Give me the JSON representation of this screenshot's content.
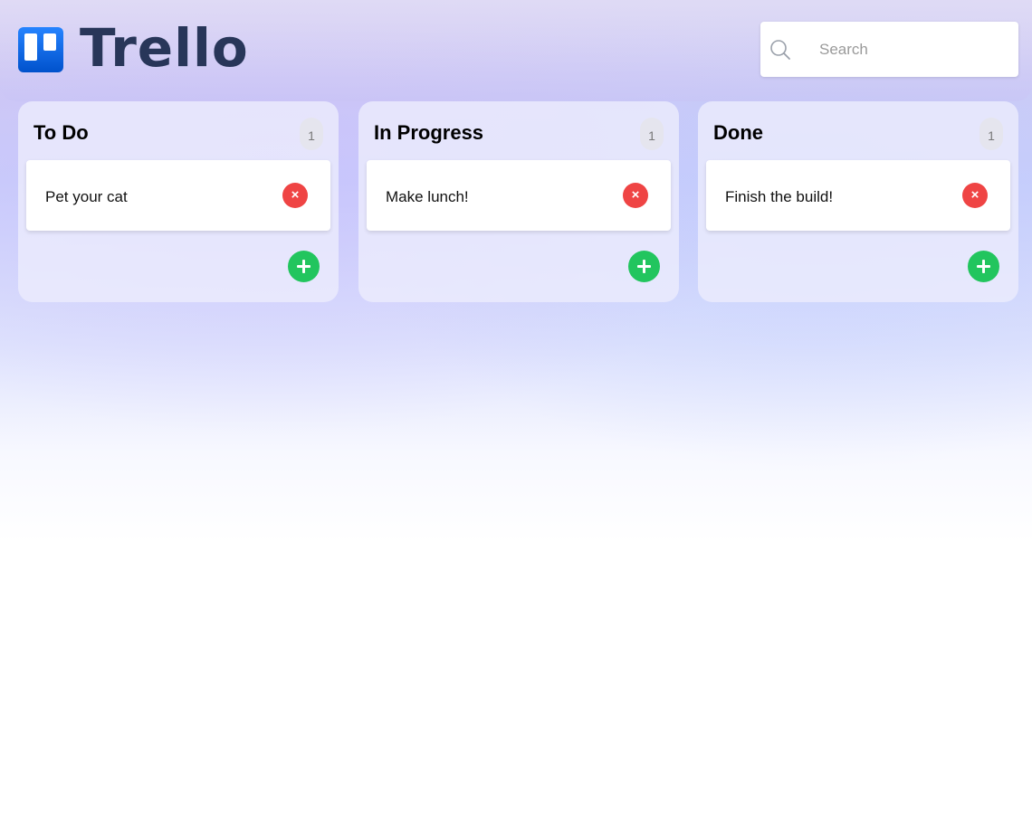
{
  "app": {
    "logo_text": "Trello"
  },
  "search": {
    "placeholder": "Search",
    "value": ""
  },
  "colors": {
    "delete": "#ef4444",
    "add": "#22c55e",
    "logo_text": "#283659"
  },
  "columns": [
    {
      "title": "To Do",
      "count": "1",
      "cards": [
        {
          "text": "Pet your cat",
          "delete_icon": "×"
        }
      ],
      "add_icon": "plus-icon"
    },
    {
      "title": "In Progress",
      "count": "1",
      "cards": [
        {
          "text": "Make lunch!",
          "delete_icon": "×"
        }
      ],
      "add_icon": "plus-icon"
    },
    {
      "title": "Done",
      "count": "1",
      "cards": [
        {
          "text": "Finish the build!",
          "delete_icon": "×"
        }
      ],
      "add_icon": "plus-icon"
    }
  ]
}
